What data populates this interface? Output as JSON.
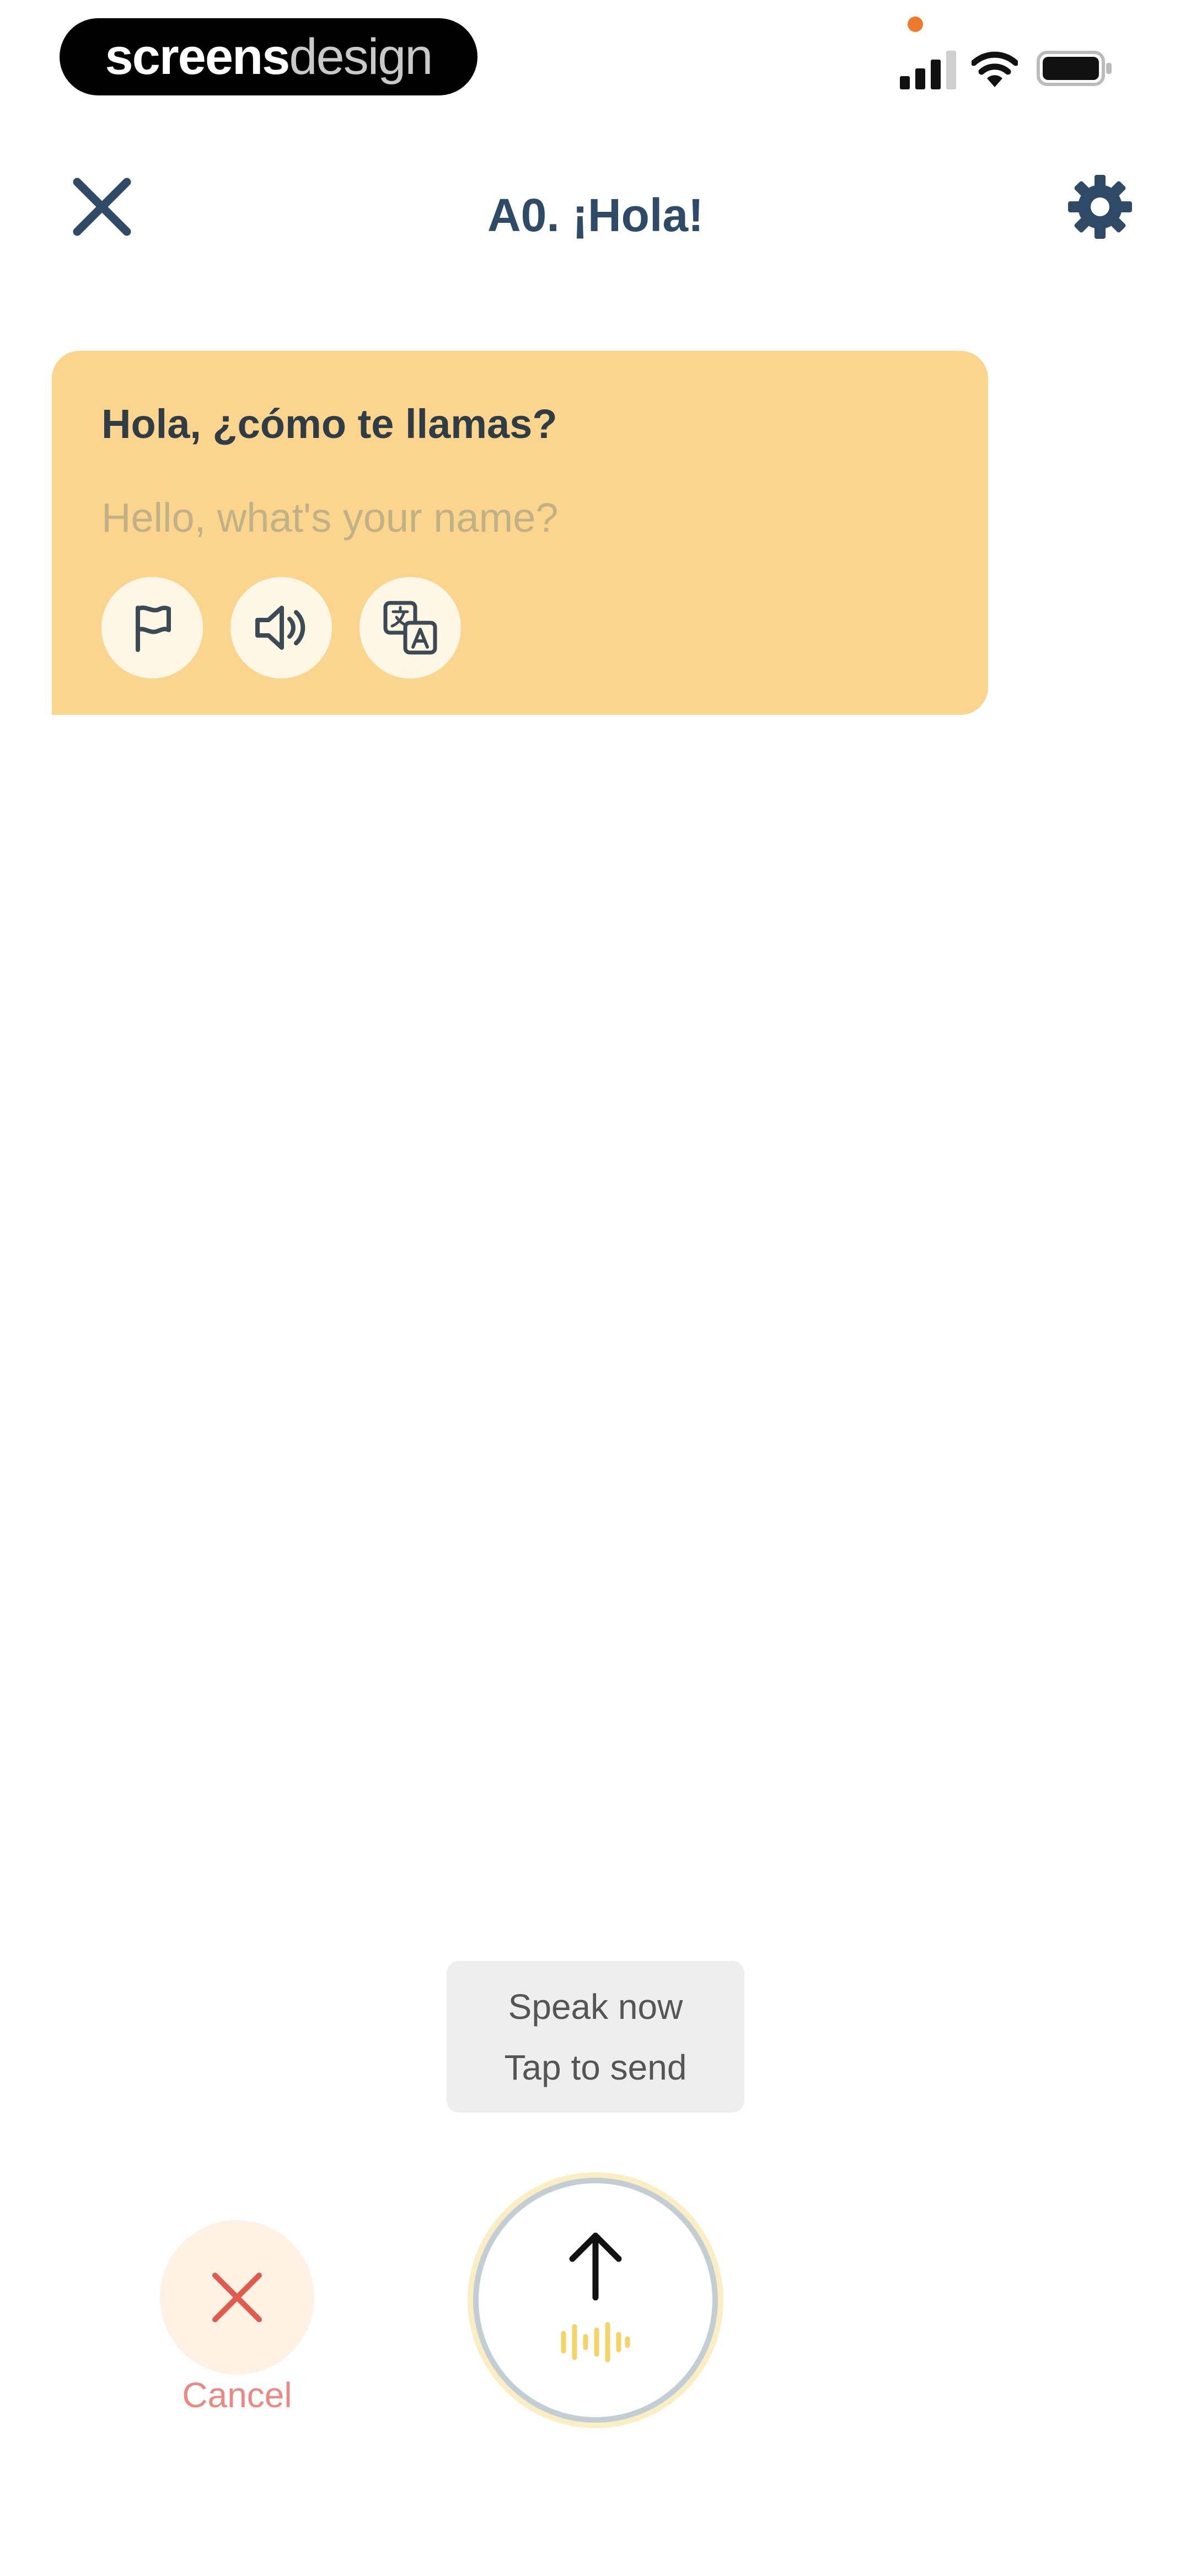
{
  "status_bar": {
    "watermark_bold": "screens",
    "watermark_light": "design",
    "signal_icon": "cellular-signal-icon",
    "wifi_icon": "wifi-icon",
    "battery_icon": "battery-icon"
  },
  "header": {
    "title": "A0. ¡Hola!",
    "close_icon": "close-icon",
    "settings_icon": "gear-icon"
  },
  "message": {
    "text": "Hola, ¿cómo te llamas?",
    "translation": "Hello, what's your name?",
    "actions": [
      {
        "icon": "flag-icon"
      },
      {
        "icon": "speaker-icon"
      },
      {
        "icon": "translate-icon"
      }
    ]
  },
  "speak_prompt": {
    "line1": "Speak now",
    "line2": "Tap to send"
  },
  "controls": {
    "cancel_label": "Cancel",
    "cancel_icon": "close-icon",
    "send_icon": "arrow-up-icon",
    "wave_icon": "sound-wave-icon"
  },
  "colors": {
    "title": "#2e4a66",
    "bubble": "#fbd58e",
    "cancel": "#e05a4e",
    "wave": "#f4d36b"
  }
}
